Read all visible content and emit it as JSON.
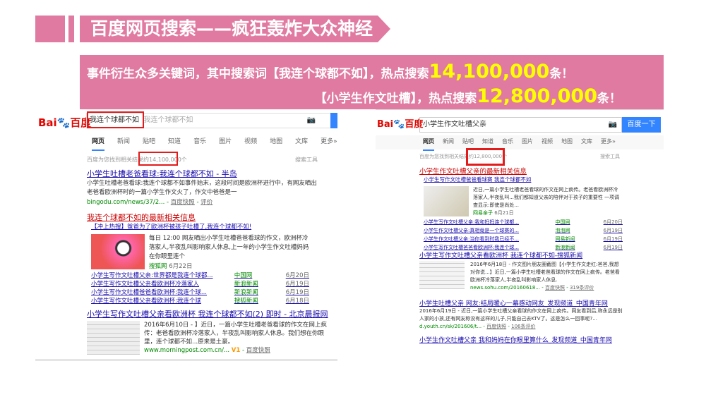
{
  "slide": {
    "title": "百度网页搜索——疯狂轰炸大众神经",
    "line1": "事件衍生众多关键词，其中搜索词【我连个球都不如】，热点搜索",
    "num1": "14,100,000",
    "unit1": "条！",
    "line2": "【小学生作文吐槽】，热点搜索",
    "num2": "12,800,000",
    "unit2": "条！",
    "accent": "#e07aa0"
  },
  "left": {
    "logo_a": "Bai",
    "logo_b": "百度",
    "query": "我连个球都不如",
    "suggest": "我连个球都不如",
    "tabs": [
      "网页",
      "新闻",
      "贴吧",
      "知道",
      "音乐",
      "图片",
      "视频",
      "地图",
      "文库",
      "更多»"
    ],
    "count_prefix": "百度为您找到相关结果约",
    "count": "14,100,000个",
    "tools": "搜索工具",
    "r1": {
      "title": "小学生吐槽老爸看球:我连个球都不如 - 半岛",
      "abstract": "小学生吐槽老爸看球:我连个球都不如事件始末，这段时间是欧洲杯进行中，有网友晒出老爸看欧洲杯时的一篇小学生作文火了，作文中爸爸是一",
      "url": "bingodu.com/news/37/2...",
      "snap": "百度快照",
      "eval": "评价"
    },
    "r2": {
      "title": "我连个球都不如的最新相关信息",
      "subtitle": "【冲上热搜】爸爸为了欧洲杯被孩子吐槽了,我连个球都不如!",
      "abstract": "每日 12:00 网友晒出小学生吐槽爸爸看球的作文，欧洲杯冷落家人,半夜乱叫影响家人休息,上一年的小学生作文吐槽妈妈在你眼里连个",
      "source": "搜狐网",
      "date": "6月22日",
      "subs": [
        {
          "t": "小学生写作文吐槽父亲:世界都是我连个球都...",
          "s": "中国网",
          "d": "6月20日"
        },
        {
          "t": "小学生写作文吐槽父亲看欧洲杯冷落家人",
          "s": "新浪新闻",
          "d": "6月19日"
        },
        {
          "t": "小学生写作文吐槽爸爸看欧洲杯:我连个球...",
          "s": "新浪新闻",
          "d": "6月19日"
        },
        {
          "t": "小学生写作文吐槽父亲看欧洲杯:我连个球",
          "s": "搜狐新闻",
          "d": "6月18日"
        }
      ]
    },
    "r3": {
      "title": "小学生写作文吐槽父亲看欧洲杯 我连个球都不如(2) 即时 - 北京晨报网",
      "abstract": "2016年6月10日 - 】近日，一篇小学生吐槽老爸看球的作文在网上疯传：老爸看欧洲杯冷落家人，半夜乱叫影响家人休息。我们想在你眼里，连个球都不如...原来是土豪。",
      "url": "www.morningpost.com.cn/...",
      "v": "V1",
      "snap": "百度快照"
    }
  },
  "right": {
    "logo_a": "Bai",
    "logo_b": "百度",
    "query": "小学生作文吐槽父亲",
    "button": "百度一下",
    "tabs": [
      "网页",
      "新闻",
      "贴吧",
      "知道",
      "音乐",
      "图片",
      "视频",
      "地图",
      "文库",
      "更多»"
    ],
    "count_prefix": "百度为您找到相关结果约",
    "count": "12,800,000个",
    "tools": "搜索工具",
    "r1": {
      "title": "小学生作文吐槽父亲的最新相关信息",
      "subtitle": "小学生写作文吐槽爸爸看球赛 我连个球都不如",
      "abstract": "近日,一篇小学生吐槽老爸看球的作文在网上疯传。老爸看欧洲杯冷落家人,半夜乱叫...我们都知道父亲的陪伴对于孩子的重要性 一项调查显示:即使是尚处...",
      "source": "网易亲子",
      "date": "6月21日",
      "subs": [
        {
          "t": "小学生写作文吐槽父亲:我和妈妈连个球都...",
          "s": "中国网",
          "d": "6月20日"
        },
        {
          "t": "小学生作文吐槽父亲:真相竟是一个球赛的...",
          "s": "泡泡网",
          "d": "6月19日"
        },
        {
          "t": "小学生作文吐槽父亲:当你看到时我已经不...",
          "s": "网易新闻",
          "d": "6月19日"
        },
        {
          "t": "小学生写作文吐槽爸爸看欧洲杯:我连个球...",
          "s": "新浪新闻",
          "d": "6月19日"
        }
      ]
    },
    "r2": {
      "title": "小学生写作文吐槽父亲看欧洲杯 我连个球都不如-搜狐新闻",
      "abstract": "2016年6月18日 - 作文图片朋友圈截图【小学生作文走红:爸爸,我想对你说...】近日,一篇小学生吐槽老爸看球的作文在网上疯传。老爸看欧洲杯冷落家人,半夜乱叫影响家人休息.",
      "url": "news.sohu.com/20160618...",
      "snap": "百度快照",
      "eval": "319条评价"
    },
    "r3": {
      "title": "小学生吐槽父亲 网友:结局暖心一幕感动网友_发现频道_中国青年网",
      "abstract": "2016年6月19日 - 近日,一篇小学生吐槽父亲看球的作文在网上疯传。网友看到后,称永远是别人家的小孩,还有网友称没有这样的儿子,只能自己去KTV了。这是怎么一回事呢?...",
      "url": "d.youth.cn/sk/201606/t...",
      "snap": "百度快照",
      "eval": "106条评价"
    },
    "r4": {
      "title": "小学生作文吐槽父亲 我和妈妈在你眼里算什么_发现频道_中国青年网"
    }
  }
}
